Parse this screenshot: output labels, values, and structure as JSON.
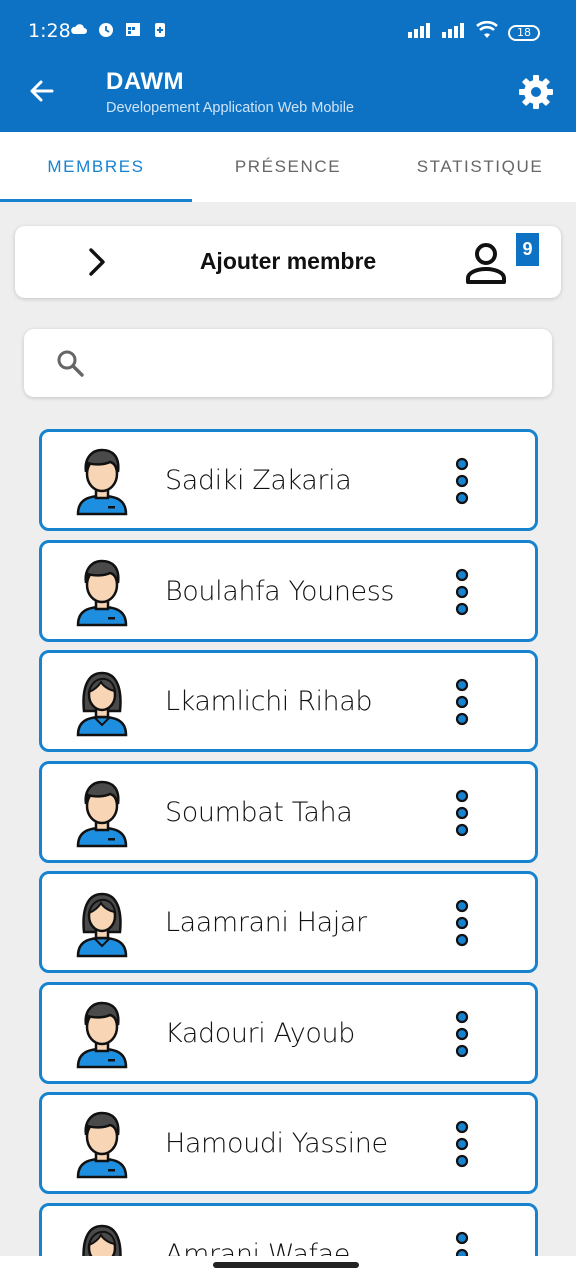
{
  "status_bar": {
    "time": "1:28",
    "battery": "18"
  },
  "header": {
    "title": "DAWM",
    "subtitle": "Developement Application  Web Mobile",
    "accent_color": "#0d72c4"
  },
  "tabs": [
    {
      "label": "MEMBRES",
      "active": true
    },
    {
      "label": "PRÉSENCE",
      "active": false
    },
    {
      "label": "STATISTIQUE",
      "active": false
    }
  ],
  "add_member": {
    "label": "Ajouter membre",
    "count": "9"
  },
  "search": {
    "value": "",
    "placeholder": ""
  },
  "members": [
    {
      "name": "Sadiki Zakaria",
      "gender": "male"
    },
    {
      "name": "Boulahfa Youness",
      "gender": "male"
    },
    {
      "name": "Lkamlichi Rihab",
      "gender": "female"
    },
    {
      "name": "Soumbat Taha",
      "gender": "male"
    },
    {
      "name": "Laamrani Hajar",
      "gender": "female"
    },
    {
      "name": "Kadouri Ayoub",
      "gender": "male"
    },
    {
      "name": "Hamoudi Yassine",
      "gender": "male"
    },
    {
      "name": "Amrani Wafae",
      "gender": "female"
    }
  ]
}
